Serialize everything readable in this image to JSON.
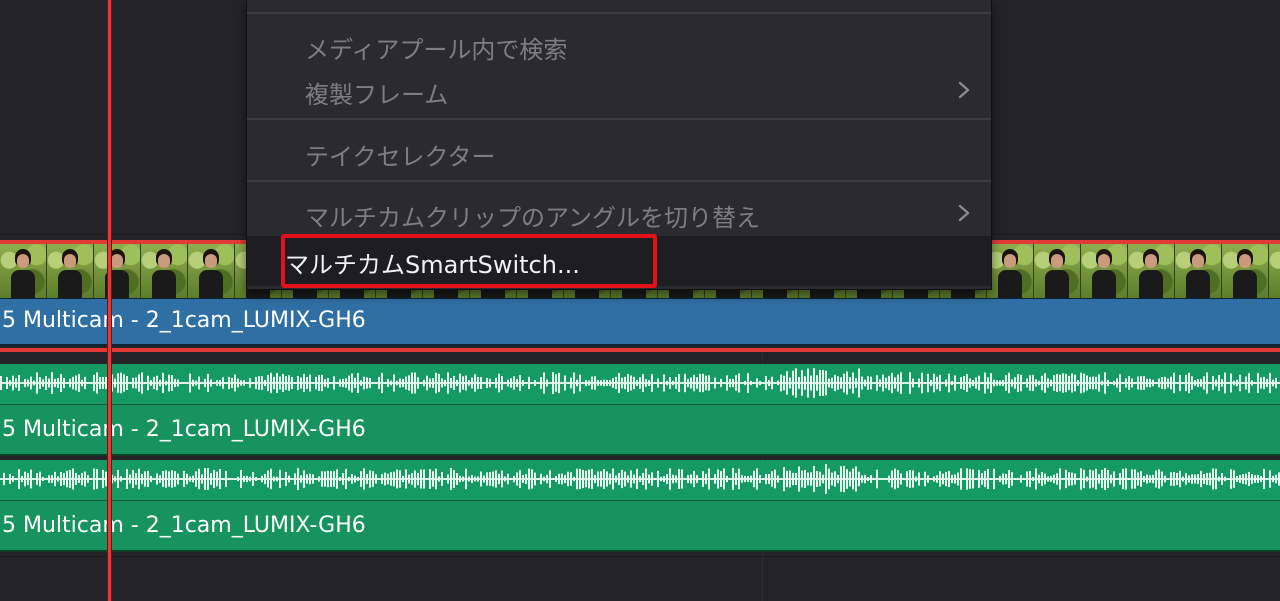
{
  "timeline": {
    "video_clip_label": "5 Multicam - 2_1cam_LUMIX-GH6",
    "audio_clips": [
      {
        "label": "5 Multicam - 2_1cam_LUMIX-GH6"
      },
      {
        "label": "5 Multicam - 2_1cam_LUMIX-GH6"
      }
    ]
  },
  "context_menu": {
    "items": [
      {
        "label": "メディアプール内で検索",
        "submenu": false,
        "highlighted": false
      },
      {
        "label": "複製フレーム",
        "submenu": true,
        "highlighted": false
      },
      {
        "label": "テイクセレクター",
        "submenu": false,
        "highlighted": false
      },
      {
        "label": "マルチカムクリップのアングルを切り替え",
        "submenu": true,
        "highlighted": false
      },
      {
        "label": "マルチカムSmartSwitch...",
        "submenu": false,
        "highlighted": true
      }
    ]
  },
  "colors": {
    "background": "#232329",
    "video_clip": "#2f6fa3",
    "audio_clip": "#169a63",
    "playhead": "#e23b36",
    "annotation_frame": "#e5111a"
  },
  "icons": {
    "submenu_arrow": "chevron-right-icon"
  }
}
